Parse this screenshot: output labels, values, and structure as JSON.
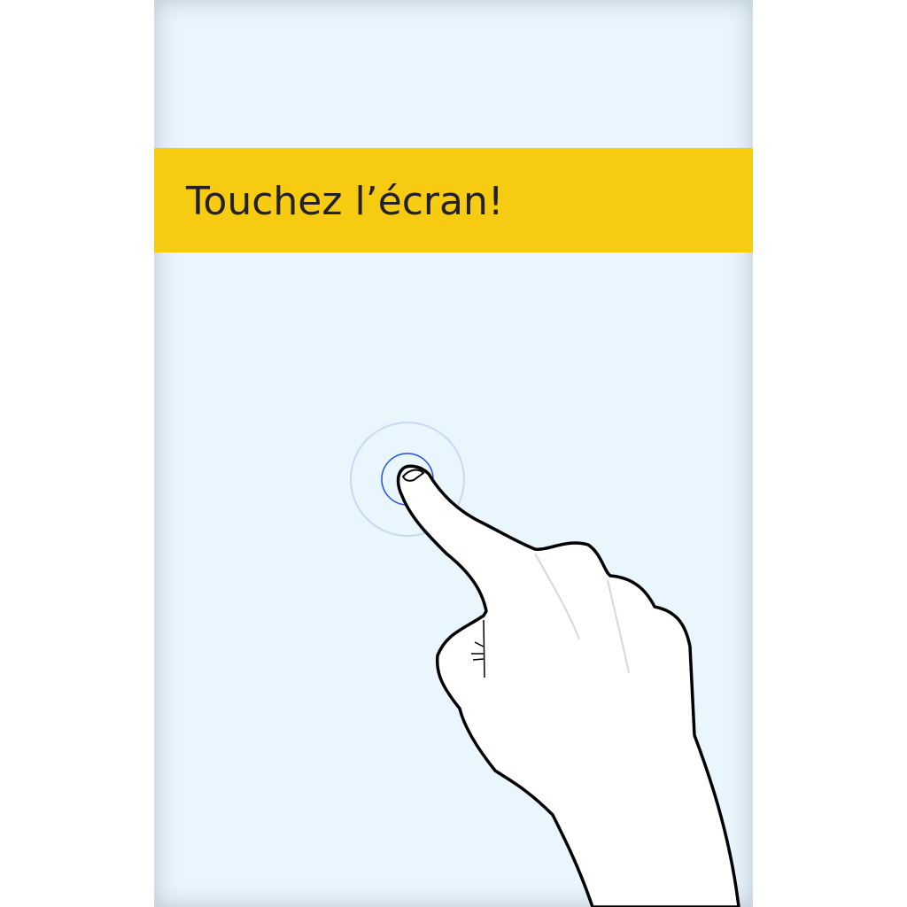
{
  "banner": {
    "text": "Touchez l’écran!"
  },
  "colors": {
    "screen_background": "#eaf6fd",
    "banner_background": "#f7cb12",
    "banner_text": "#222222",
    "touch_ring_outer": "#c7d7f5",
    "touch_ring_inner": "#2450e0",
    "hand_outline": "#000000"
  },
  "icons": {
    "touch_indicator": "touch-ripple-icon",
    "hand": "pointing-hand-icon"
  }
}
